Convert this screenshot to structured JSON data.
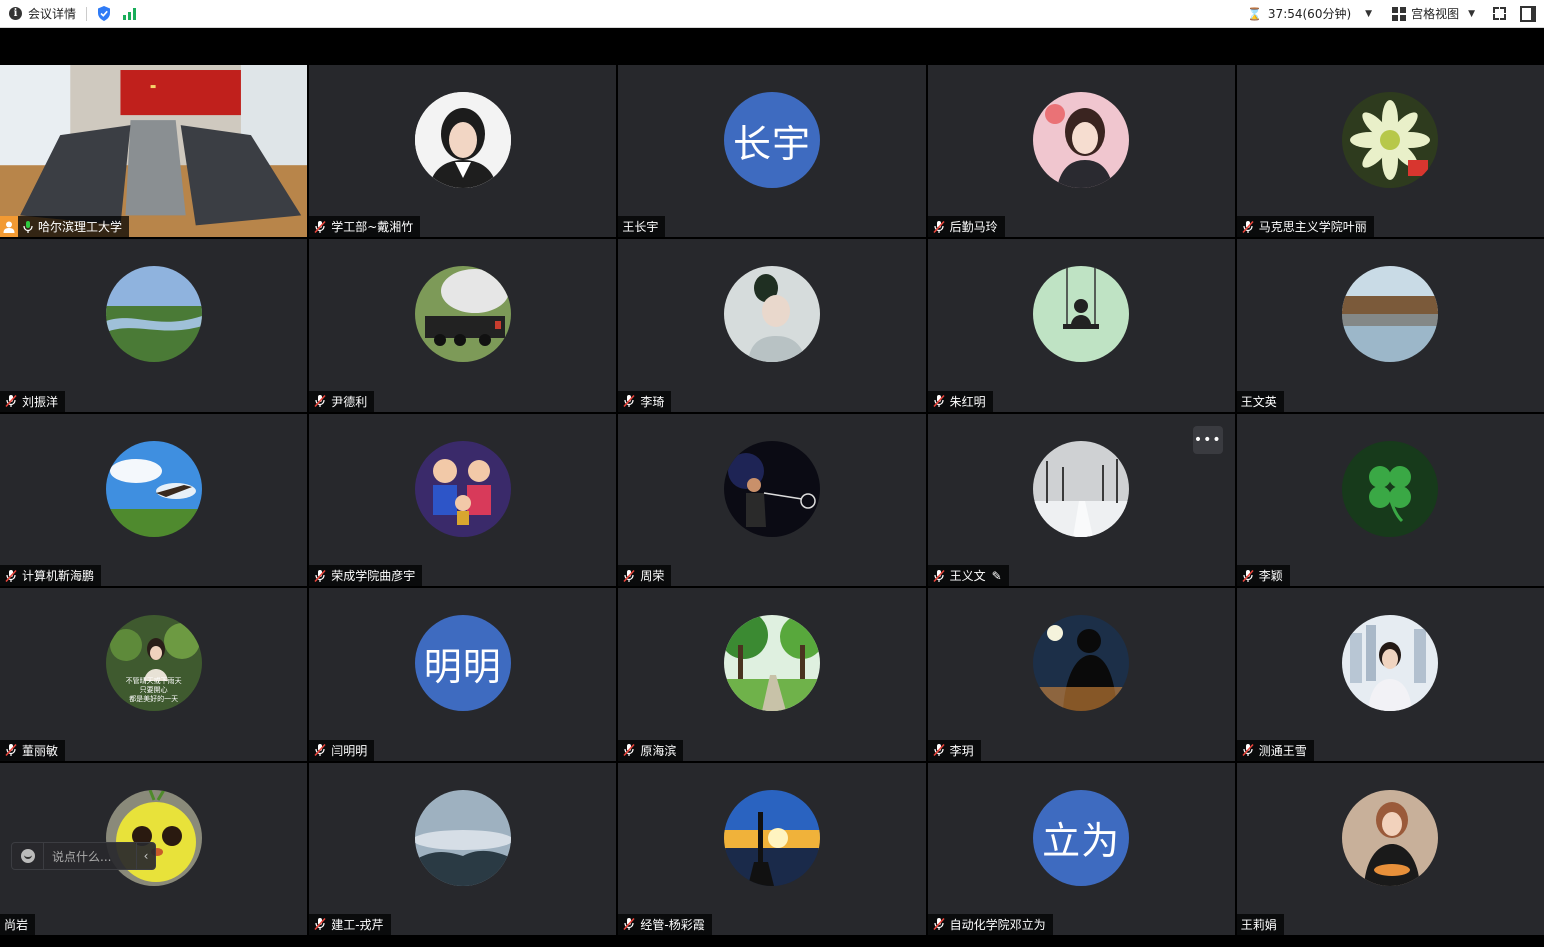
{
  "topbar": {
    "title": "会议详情",
    "timer": "37:54(60分钟)",
    "view_mode": "宫格视图"
  },
  "chat": {
    "placeholder": "说点什么..."
  },
  "participants": [
    {
      "name": "哈尔滨理工大学",
      "muted": false,
      "host": true,
      "video": "meeting-room"
    },
    {
      "name": "学工部~戴湘竹",
      "muted": true,
      "avatar": "woman-portrait"
    },
    {
      "name": "王长宇",
      "muted": false,
      "avatar_text": "长宇"
    },
    {
      "name": "后勤马玲",
      "muted": true,
      "avatar": "woman-selfie"
    },
    {
      "name": "马克思主义学院叶丽",
      "muted": true,
      "avatar": "cactus-flower"
    },
    {
      "name": "刘振洋",
      "muted": true,
      "avatar": "river-landscape"
    },
    {
      "name": "尹德利",
      "muted": true,
      "avatar": "steam-train"
    },
    {
      "name": "李琦",
      "muted": true,
      "avatar": "man-with-plant"
    },
    {
      "name": "朱红明",
      "muted": true,
      "avatar": "girl-on-swing"
    },
    {
      "name": "王文英",
      "muted": false,
      "avatar": "lake-reflection"
    },
    {
      "name": "计算机靳海鹏",
      "muted": true,
      "avatar": "eagle-sky"
    },
    {
      "name": "荣成学院曲彦宇",
      "muted": true,
      "avatar": "cartoon-family"
    },
    {
      "name": "周荣",
      "muted": true,
      "avatar": "badminton-player"
    },
    {
      "name": "王义文",
      "muted": true,
      "avatar": "snowy-road",
      "editing": true
    },
    {
      "name": "李颖",
      "muted": true,
      "avatar": "four-leaf-clover"
    },
    {
      "name": "董丽敏",
      "muted": true,
      "avatar": "woman-lotus",
      "avatar_caption": [
        "不管晴天或下雨天",
        "只要開心",
        "都是美好的一天"
      ]
    },
    {
      "name": "闫明明",
      "muted": true,
      "avatar_text": "明明"
    },
    {
      "name": "原海滨",
      "muted": true,
      "avatar": "tree-path"
    },
    {
      "name": "李玥",
      "muted": true,
      "avatar": "city-silhouette"
    },
    {
      "name": "测通王雪",
      "muted": true,
      "avatar": "woman-city"
    },
    {
      "name": "尚岩",
      "muted": false,
      "avatar": "yellow-bird-plush"
    },
    {
      "name": "建工-戎芹",
      "muted": true,
      "avatar": "misty-mountains"
    },
    {
      "name": "经管-杨彩霞",
      "muted": true,
      "avatar": "lighthouse-sunset"
    },
    {
      "name": "自动化学院邓立为",
      "muted": true,
      "avatar_text": "立为"
    },
    {
      "name": "王莉娟",
      "muted": false,
      "avatar": "woman-pizza"
    }
  ],
  "colors": {
    "tile_bg": "#27282c",
    "active_border": "#22c04f",
    "text_avatar_bg": "#3e6bc0",
    "host_badge": "#f29a33"
  }
}
